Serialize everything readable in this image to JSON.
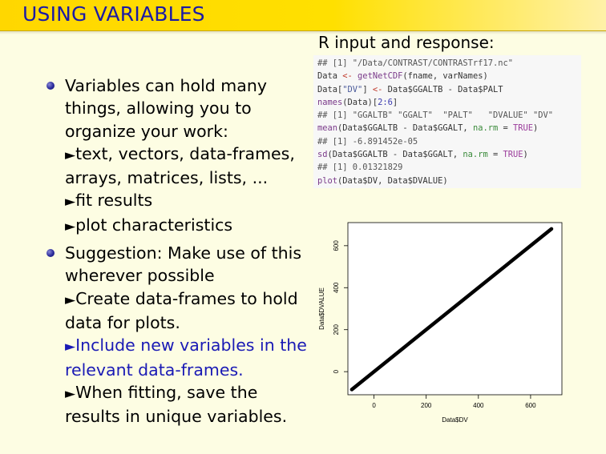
{
  "slide": {
    "title": "USING VARIABLES"
  },
  "bullets": [
    {
      "lines": [
        {
          "text": "Variables can hold many"
        },
        {
          "text": "things, allowing you to"
        },
        {
          "text": "organize your work:"
        },
        {
          "arrow": "►",
          "text": "text, vectors, data-frames,"
        },
        {
          "text": "arrays, matrices, lists, ..."
        },
        {
          "arrow": "►",
          "text": "fit results"
        },
        {
          "arrow": "►",
          "text": "plot characteristics"
        }
      ]
    },
    {
      "lines": [
        {
          "text": "Suggestion: Make use of this"
        },
        {
          "text": "wherever possible"
        },
        {
          "arrow": "►",
          "text": "Create data-frames to hold"
        },
        {
          "text": "data for plots."
        },
        {
          "arrow": "►",
          "text": "Include new variables in the",
          "highlight": true
        },
        {
          "text": "relevant data-frames.",
          "highlight": true
        },
        {
          "arrow": "►",
          "text": "When fitting, save the"
        },
        {
          "text": "results in unique variables."
        }
      ]
    }
  ],
  "r_section": {
    "heading": "R input and response:",
    "code": [
      {
        "out": "## [1] \"/Data/CONTRAST/CONTRASTrf17.nc\""
      },
      {
        "pre": "Data ",
        "op": "<-",
        "fn": " getNetCDF",
        "rest": "(fname, varNames)"
      },
      {
        "pre": "Data[",
        "str": "\"DV\"",
        "mid": "] ",
        "op": "<-",
        "rest": " Data$GGALTB - Data$PALT"
      },
      {
        "fn": "names",
        "pre": "(Data)[",
        "num": "2:6",
        "rest": "]"
      },
      {
        "out": "## [1] \"GGALTB\" \"GGALT\"  \"PALT\"   \"DVALUE\" \"DV\""
      },
      {
        "fn": "mean",
        "pre": "(Data$GGALTB - Data$GGALT, ",
        "arg": "na.rm",
        "mid": " = ",
        "true": "TRUE",
        "rest": ")"
      },
      {
        "out": "## [1] -6.891452e-05"
      },
      {
        "fn": "sd",
        "pre": "(Data$GGALTB - Data$GGALT, ",
        "arg": "na.rm",
        "mid": " = ",
        "true": "TRUE",
        "rest": ")"
      },
      {
        "out": "## [1] 0.01321829"
      },
      {
        "fn": "plot",
        "pre": "(Data$DV, Data$DVALUE)"
      }
    ]
  },
  "chart_data": {
    "type": "line",
    "xlabel": "Data$DV",
    "ylabel": "Data$DVALUE",
    "xlim": [
      -100,
      720
    ],
    "ylim": [
      -110,
      710
    ],
    "x_ticks": [
      0,
      200,
      400,
      600
    ],
    "y_ticks": [
      0,
      200,
      400,
      600
    ],
    "x": [
      -85,
      680
    ],
    "y": [
      -85,
      680
    ],
    "grid": false,
    "line_color": "#000000"
  }
}
